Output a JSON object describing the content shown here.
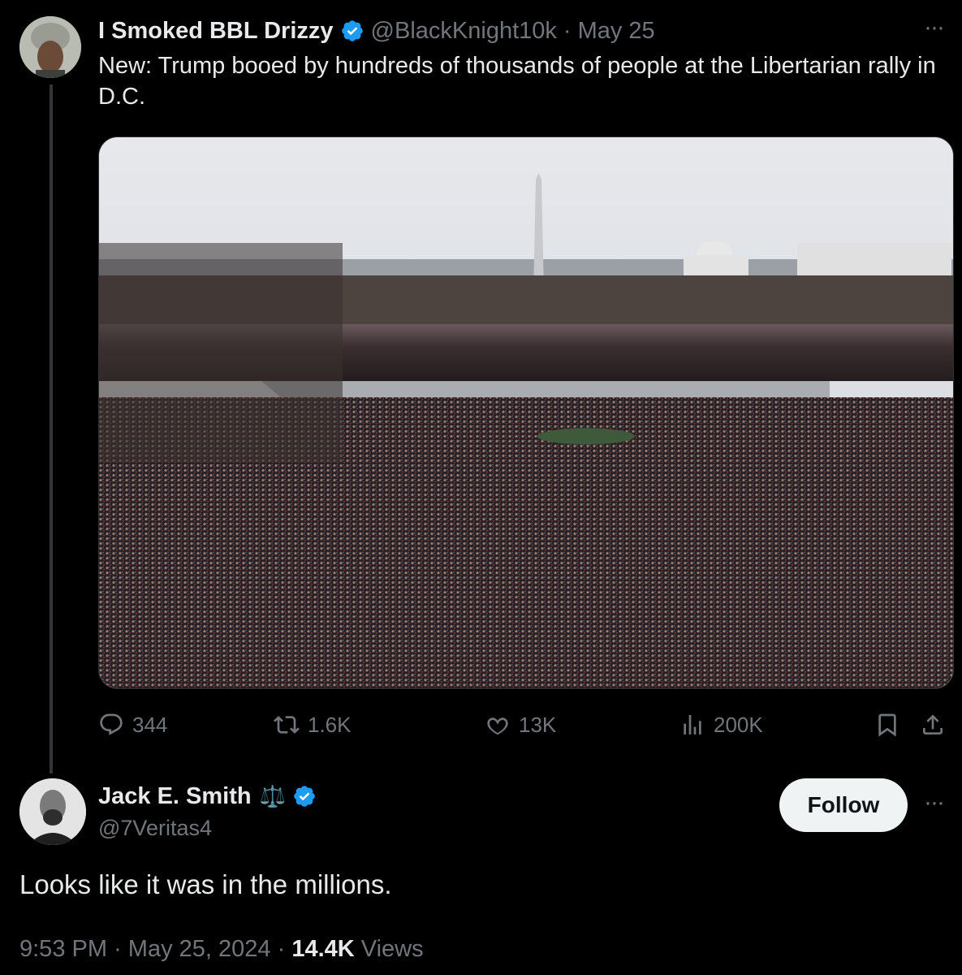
{
  "tweet": {
    "display_name": "I Smoked BBL Drizzy",
    "handle": "@BlackKnight10k",
    "separator": "·",
    "date": "May 25",
    "more": "···",
    "text": "New: Trump booed by hundreds of thousands of people at the Libertarian rally in D.C.",
    "stats": {
      "replies": "344",
      "reposts": "1.6K",
      "likes": "13K",
      "views": "200K"
    },
    "icons": [
      "verified-badge-icon",
      "reply-icon",
      "repost-icon",
      "like-icon",
      "views-icon",
      "bookmark-icon",
      "share-icon"
    ]
  },
  "reply": {
    "display_name": "Jack E. Smith",
    "emoji": "⚖️",
    "handle": "@7Veritas4",
    "follow_label": "Follow",
    "more": "···",
    "text": "Looks like it was in the millions.",
    "time": "9:53 PM",
    "sep1": "·",
    "date": "May 25, 2024",
    "sep2": "·",
    "views_count": "14.4K",
    "views_label": "Views"
  },
  "colors": {
    "background": "#000000",
    "text": "#e7e9ea",
    "muted": "#71767b",
    "verified": "#1d9bf0",
    "follow_bg": "#eff3f4"
  }
}
